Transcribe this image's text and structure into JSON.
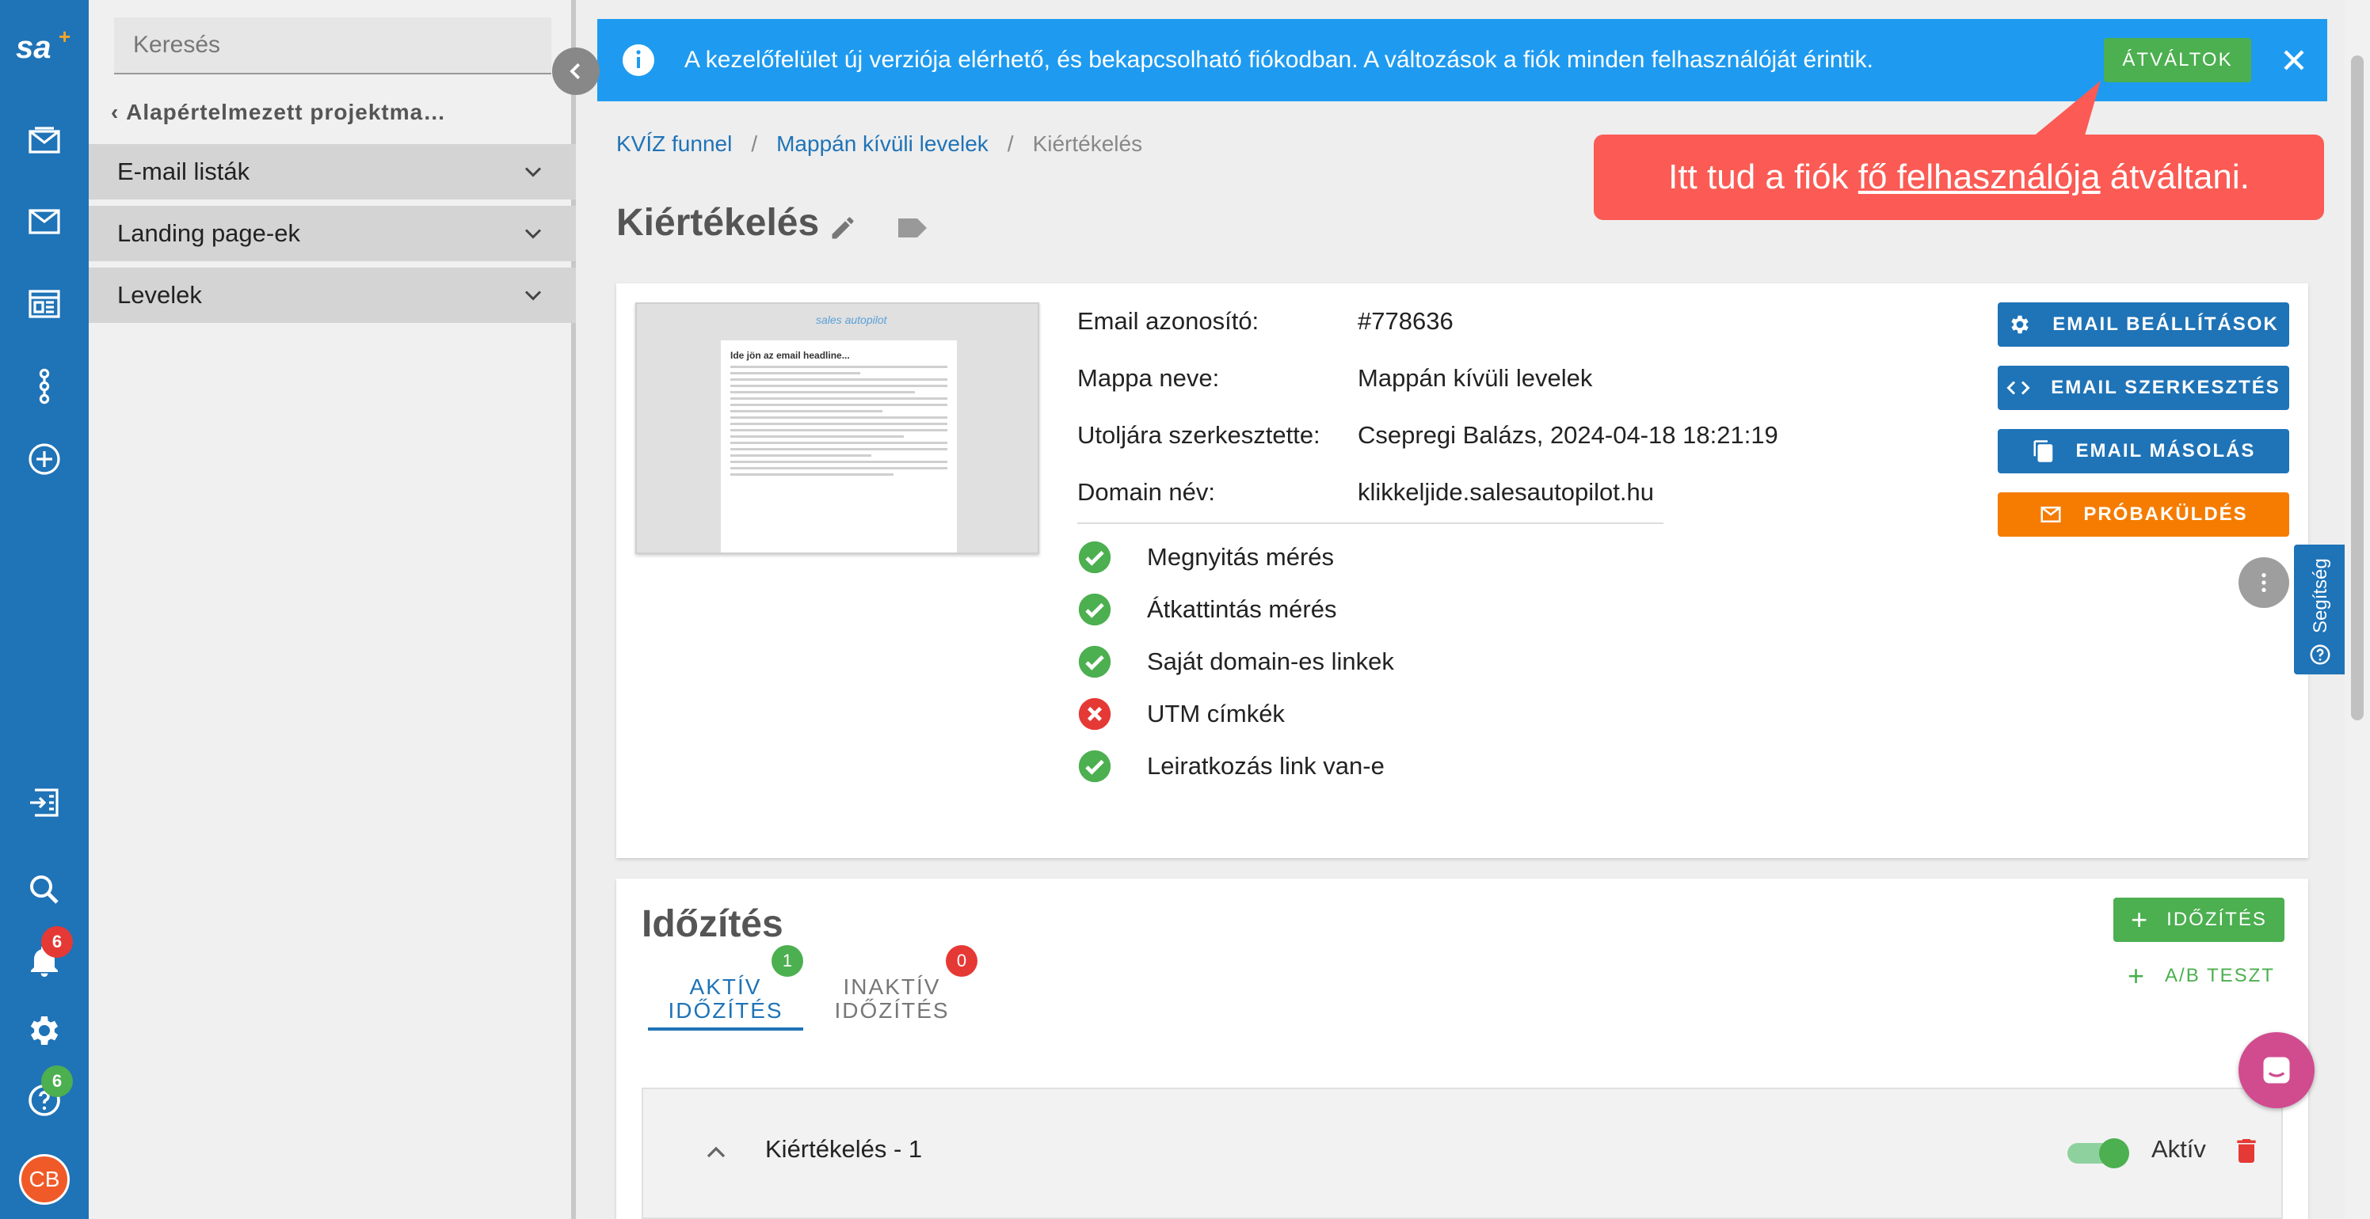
{
  "rail": {
    "logo": "sa",
    "notifications_count": "6",
    "help_count": "6",
    "avatar_initials": "CB"
  },
  "sidebar": {
    "search_placeholder": "Keresés",
    "project_back": "Alapértelmezett projektma…",
    "groups": [
      {
        "label": "E-mail listák"
      },
      {
        "label": "Landing page-ek"
      },
      {
        "label": "Levelek"
      }
    ]
  },
  "banner": {
    "message": "A kezelőfelület új verziója elérhető, és bekapcsolható fiókodban. A változások a fiók minden felhasználóját érintik.",
    "switch_label": "ÁTVÁLTOK"
  },
  "callout": {
    "prefix": "Itt tud a fiók ",
    "link": "fő felhasználója",
    "suffix": " átváltani."
  },
  "breadcrumb": {
    "items": [
      "KVÍZ funnel",
      "Mappán kívüli levelek",
      "Kiértékelés"
    ],
    "separator": "/"
  },
  "page": {
    "title": "Kiértékelés"
  },
  "email": {
    "preview_headline": "Ide jön az email headline...",
    "preview_logo": "sales autopilot",
    "fields": [
      {
        "label": "Email azonosító:",
        "value": "#778636"
      },
      {
        "label": "Mappa neve:",
        "value": "Mappán kívüli levelek"
      },
      {
        "label": "Utoljára szerkesztette:",
        "value": "Csepregi Balázs, 2024-04-18 18:21:19"
      },
      {
        "label": "Domain név:",
        "value": "klikkeljide.salesautopilot.hu"
      }
    ],
    "checks": [
      {
        "label": "Megnyitás mérés",
        "ok": true
      },
      {
        "label": "Átkattintás mérés",
        "ok": true
      },
      {
        "label": "Saját domain-es linkek",
        "ok": true
      },
      {
        "label": "UTM címkék",
        "ok": false
      },
      {
        "label": "Leiratkozás link van-e",
        "ok": true
      }
    ],
    "actions": {
      "settings": "EMAIL BEÁLLÍTÁSOK",
      "edit": "EMAIL SZERKESZTÉS",
      "copy": "EMAIL MÁSOLÁS",
      "test_send": "PRÓBAKÜLDÉS"
    }
  },
  "help_tab": {
    "label": "Segítség"
  },
  "scheduling": {
    "title": "Időzítés",
    "tab_active_line1": "AKTÍV",
    "tab_active_line2": "IDŐZÍTÉS",
    "tab_active_count": "1",
    "tab_inactive_line1": "INAKTÍV",
    "tab_inactive_line2": "IDŐZÍTÉS",
    "tab_inactive_count": "0",
    "add_button": "IDŐZÍTÉS",
    "ab_test_button": "A/B TESZT",
    "row_title": "Kiértékelés - 1",
    "toggle_label": "Aktív"
  },
  "colors": {
    "primary": "#1f73b7",
    "banner": "#1e9bf0",
    "success": "#4caf50",
    "danger": "#e53935",
    "orange": "#f57c00",
    "callout": "#fb5b54"
  }
}
